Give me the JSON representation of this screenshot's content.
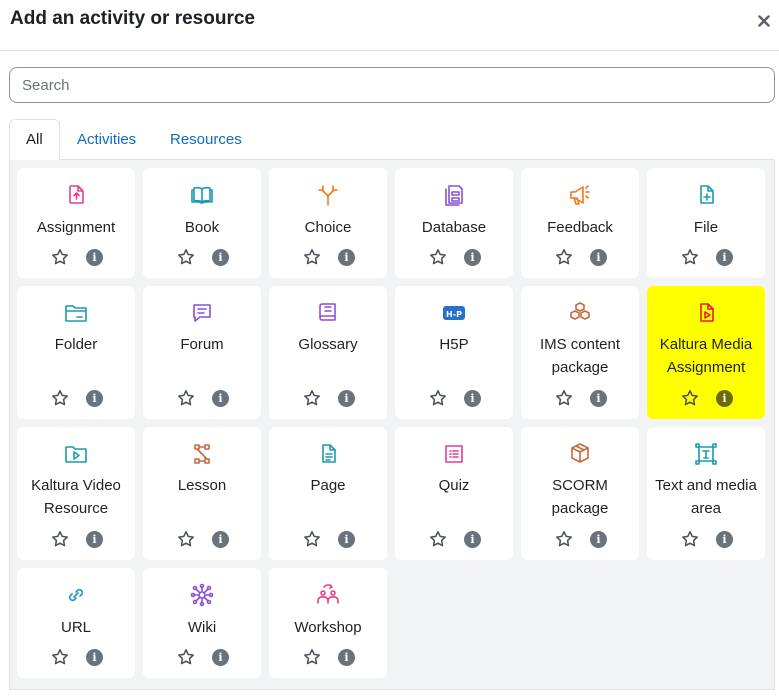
{
  "dialog": {
    "title": "Add an activity or resource",
    "close_symbol": "×"
  },
  "search": {
    "placeholder": "Search",
    "value": ""
  },
  "tabs": [
    {
      "label": "All",
      "active": true
    },
    {
      "label": "Activities",
      "active": false
    },
    {
      "label": "Resources",
      "active": false
    }
  ],
  "info_glyph": "i",
  "modules": [
    {
      "label": "Assignment",
      "icon": "assignment-icon",
      "color": "#e63d8c"
    },
    {
      "label": "Book",
      "icon": "book-icon",
      "color": "#1a9bb1"
    },
    {
      "label": "Choice",
      "icon": "choice-icon",
      "color": "#f3771c"
    },
    {
      "label": "Database",
      "icon": "database-icon",
      "color": "#8a4fd9"
    },
    {
      "label": "Feedback",
      "icon": "feedback-icon",
      "color": "#f3771c"
    },
    {
      "label": "File",
      "icon": "file-icon",
      "color": "#1a9bb1"
    },
    {
      "label": "Folder",
      "icon": "folder-icon",
      "color": "#1a9bb1"
    },
    {
      "label": "Forum",
      "icon": "forum-icon",
      "color": "#8a4fd9"
    },
    {
      "label": "Glossary",
      "icon": "glossary-icon",
      "color": "#8a4fd9"
    },
    {
      "label": "H5P",
      "icon": "h5p-icon",
      "color": "#2672c4"
    },
    {
      "label": "IMS content package",
      "icon": "ims-package-icon",
      "color": "#c4693d"
    },
    {
      "label": "Kaltura Media Assignment",
      "icon": "kaltura-media-icon",
      "color": "#e81b3b",
      "highlighted": true
    },
    {
      "label": "Kaltura Video Resource",
      "icon": "kaltura-video-icon",
      "color": "#1a9bb1"
    },
    {
      "label": "Lesson",
      "icon": "lesson-icon",
      "color": "#c4693d"
    },
    {
      "label": "Page",
      "icon": "page-icon",
      "color": "#1a9bb1"
    },
    {
      "label": "Quiz",
      "icon": "quiz-icon",
      "color": "#e63d8c"
    },
    {
      "label": "SCORM package",
      "icon": "scorm-icon",
      "color": "#c4693d"
    },
    {
      "label": "Text and media area",
      "icon": "text-media-icon",
      "color": "#1a9bb1"
    },
    {
      "label": "URL",
      "icon": "url-icon",
      "color": "#1a9bb1"
    },
    {
      "label": "Wiki",
      "icon": "wiki-icon",
      "color": "#8a4fd9"
    },
    {
      "label": "Workshop",
      "icon": "workshop-icon",
      "color": "#e63d8c"
    }
  ]
}
